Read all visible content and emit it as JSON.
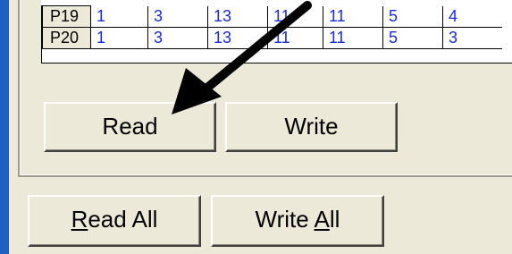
{
  "grid": {
    "rows": [
      {
        "label": "P19",
        "cells": [
          "1",
          "3",
          "13",
          "11",
          "11",
          "5",
          "4"
        ]
      },
      {
        "label": "P20",
        "cells": [
          "1",
          "3",
          "13",
          "11",
          "11",
          "5",
          "3"
        ]
      }
    ]
  },
  "buttons": {
    "read": "Read",
    "write": "Write",
    "read_all_mnemonic": "R",
    "read_all_rest": "ead All",
    "write_all_prefix": "Write ",
    "write_all_mnemonic": "A",
    "write_all_rest": "ll"
  },
  "colors": {
    "cell_text": "#1a2bd0",
    "background": "#ece9d8",
    "window_frame": "#1f5fbf"
  },
  "icons": {
    "pointer": "arrow-pointer-icon"
  }
}
